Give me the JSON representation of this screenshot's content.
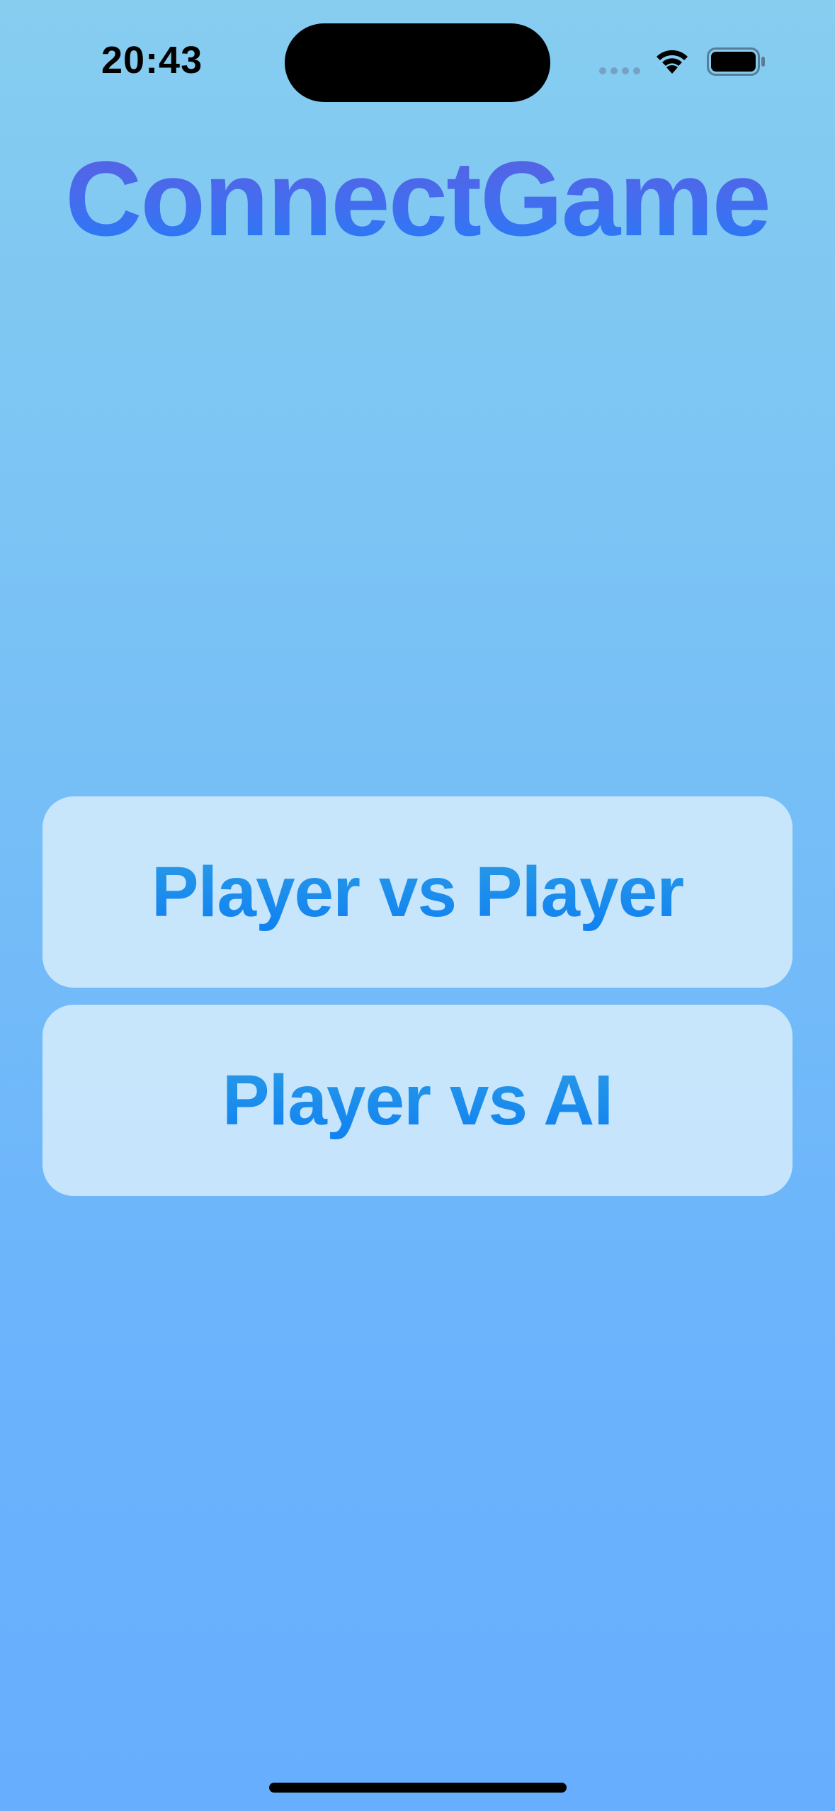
{
  "status_bar": {
    "time": "20:43",
    "icons": [
      "cellular-signal-icon",
      "wifi-icon",
      "battery-icon"
    ]
  },
  "app": {
    "title": "ConnectGame"
  },
  "menu": {
    "buttons": [
      {
        "label": "Player vs Player"
      },
      {
        "label": "Player vs AI"
      }
    ]
  },
  "colors": {
    "background_top": "#86cdf0",
    "background_bottom": "#67aefe",
    "title_gradient_top": "#5f5ee0",
    "title_gradient_bottom": "#1f7ef8",
    "button_fill": "#d6ecfc",
    "button_text": "#1a8af0"
  }
}
